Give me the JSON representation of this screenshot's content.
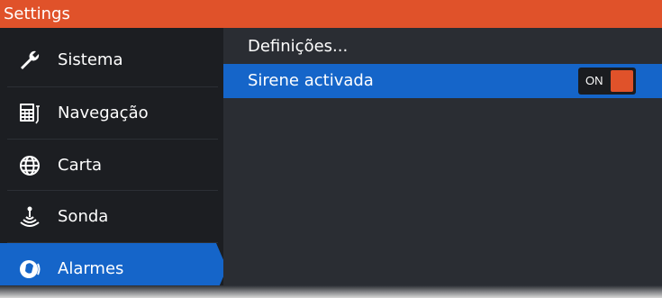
{
  "window": {
    "title": "Settings"
  },
  "sidebar": {
    "items": [
      {
        "label": "Sistema",
        "icon": "wrench-icon"
      },
      {
        "label": "Navegação",
        "icon": "calculator-icon"
      },
      {
        "label": "Carta",
        "icon": "globe-icon"
      },
      {
        "label": "Sonda",
        "icon": "sonar-icon"
      },
      {
        "label": "Alarmes",
        "icon": "alarm-bell-icon",
        "active": true
      }
    ]
  },
  "main": {
    "rows": [
      {
        "label": "Definições..."
      },
      {
        "label": "Sirene activada",
        "toggle": {
          "state": "ON",
          "on": true
        }
      }
    ]
  },
  "colors": {
    "accent": "#e0522a",
    "selection": "#1565c9",
    "sidebar_bg": "#1c1e22",
    "panel_bg": "#2a2d33"
  }
}
